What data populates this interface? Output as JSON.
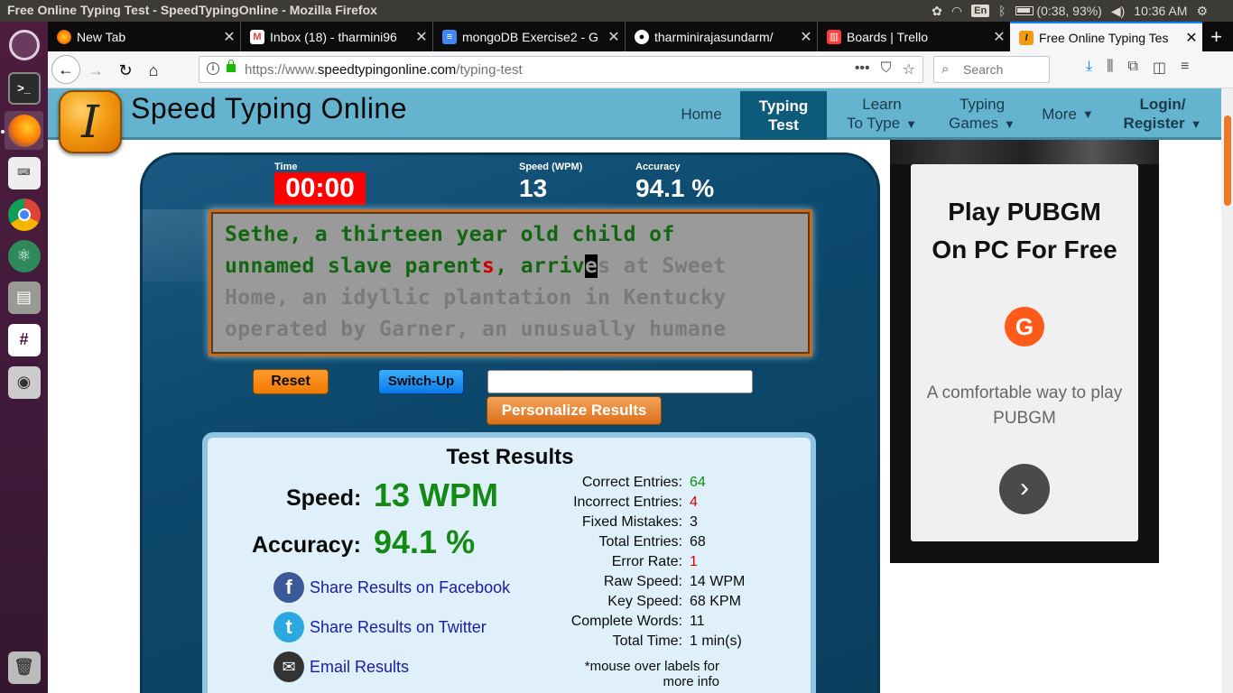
{
  "os": {
    "window_title": "Free Online Typing Test - SpeedTypingOnline - Mozilla Firefox",
    "kbd_layout": "En",
    "battery": "(0:38, 93%)",
    "clock": "10:36 AM"
  },
  "browser": {
    "tabs": [
      {
        "label": "New Tab"
      },
      {
        "label": "Inbox (18) - tharmini96"
      },
      {
        "label": "mongoDB Exercise2 - G"
      },
      {
        "label": "tharminirajasundarm/"
      },
      {
        "label": "Boards | Trello"
      },
      {
        "label": "Free Online Typing Tes"
      }
    ],
    "url_prefix": "https://www.",
    "url_host": "speedtypingonline.com",
    "url_path": "/typing-test",
    "search_placeholder": "Search"
  },
  "site": {
    "brand": "Speed Typing Online",
    "logo_glyph": "I",
    "nav": [
      {
        "line1": "Home",
        "line2": ""
      },
      {
        "line1": "Typing",
        "line2": "Test"
      },
      {
        "line1": "Learn",
        "line2": "To Type"
      },
      {
        "line1": "Typing",
        "line2": "Games"
      },
      {
        "line1": "More",
        "line2": ""
      },
      {
        "line1": "Login/",
        "line2": "Register"
      }
    ]
  },
  "test": {
    "time_label": "Time",
    "time_value": "00:00",
    "speed_label": "Speed (WPM)",
    "speed_value": "13",
    "accuracy_label": "Accuracy",
    "accuracy_value": "94.1 %",
    "lines": [
      {
        "typed": "Sethe, a thirteen year old child of",
        "wrong": "",
        "mid": "",
        "cursor": "",
        "rest": ""
      },
      {
        "typed": "unnamed slave parent",
        "wrong": "s",
        "mid": ", arriv",
        "cursor": "e",
        "rest": "s at Sweet"
      },
      {
        "typed": "",
        "wrong": "",
        "mid": "",
        "cursor": "",
        "rest": "Home, an idyllic plantation in Kentucky"
      },
      {
        "typed": "",
        "wrong": "",
        "mid": "",
        "cursor": "",
        "rest": "operated by Garner, an unusually humane"
      }
    ],
    "reset_label": "Reset",
    "switchup_label": "Switch-Up",
    "personalize_label": "Personalize Results"
  },
  "results": {
    "title": "Test Results",
    "speed_label": "Speed:",
    "speed_value": "13 WPM",
    "accuracy_label": "Accuracy:",
    "accuracy_value": "94.1 %",
    "share_facebook": "Share Results on Facebook",
    "share_twitter": "Share Results on Twitter",
    "email": "Email Results",
    "stats": [
      {
        "k": "Correct Entries:",
        "v": "64",
        "color": "green"
      },
      {
        "k": "Incorrect Entries:",
        "v": "4",
        "color": "red"
      },
      {
        "k": "Fixed Mistakes:",
        "v": "3",
        "color": ""
      },
      {
        "k": "Total Entries:",
        "v": "68",
        "color": ""
      },
      {
        "k": "Error Rate:",
        "v": "1",
        "color": "red"
      },
      {
        "k": "Raw Speed:",
        "v": "14 WPM",
        "color": ""
      },
      {
        "k": "Key Speed:",
        "v": "68 KPM",
        "color": ""
      },
      {
        "k": "Complete Words:",
        "v": "11",
        "color": ""
      },
      {
        "k": "Total Time:",
        "v": "1 min(s)",
        "color": ""
      }
    ],
    "note": "*mouse over labels for more info"
  },
  "ad": {
    "headline1": "Play PUBGM",
    "headline2": "On PC For Free",
    "tagline": "A comfortable way to play PUBGM",
    "go_glyph": "›"
  }
}
